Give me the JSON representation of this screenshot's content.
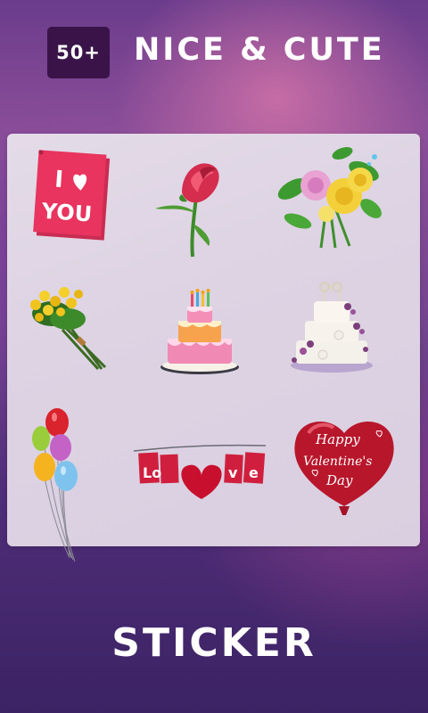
{
  "header": {
    "badge": "50+",
    "title": "NICE & CUTE"
  },
  "stickers": [
    {
      "icon": "i-love-you-card-icon",
      "lines": [
        "I",
        "YOU"
      ]
    },
    {
      "icon": "red-rose-icon"
    },
    {
      "icon": "rose-bouquet-icon"
    },
    {
      "icon": "yellow-rose-bunch-icon"
    },
    {
      "icon": "birthday-cake-icon"
    },
    {
      "icon": "wedding-cake-icon"
    },
    {
      "icon": "balloons-icon"
    },
    {
      "icon": "love-banner-icon",
      "letters": [
        "Lo",
        "v",
        "e"
      ]
    },
    {
      "icon": "valentine-heart-balloon-icon",
      "lines": [
        "Happy",
        "Valentine's",
        "Day"
      ]
    }
  ],
  "colors": {
    "badge_bg": "#3a1449",
    "card_pink": "#e8345e",
    "heart_red": "#b8162b"
  },
  "footer": {
    "title": "STICKER"
  }
}
